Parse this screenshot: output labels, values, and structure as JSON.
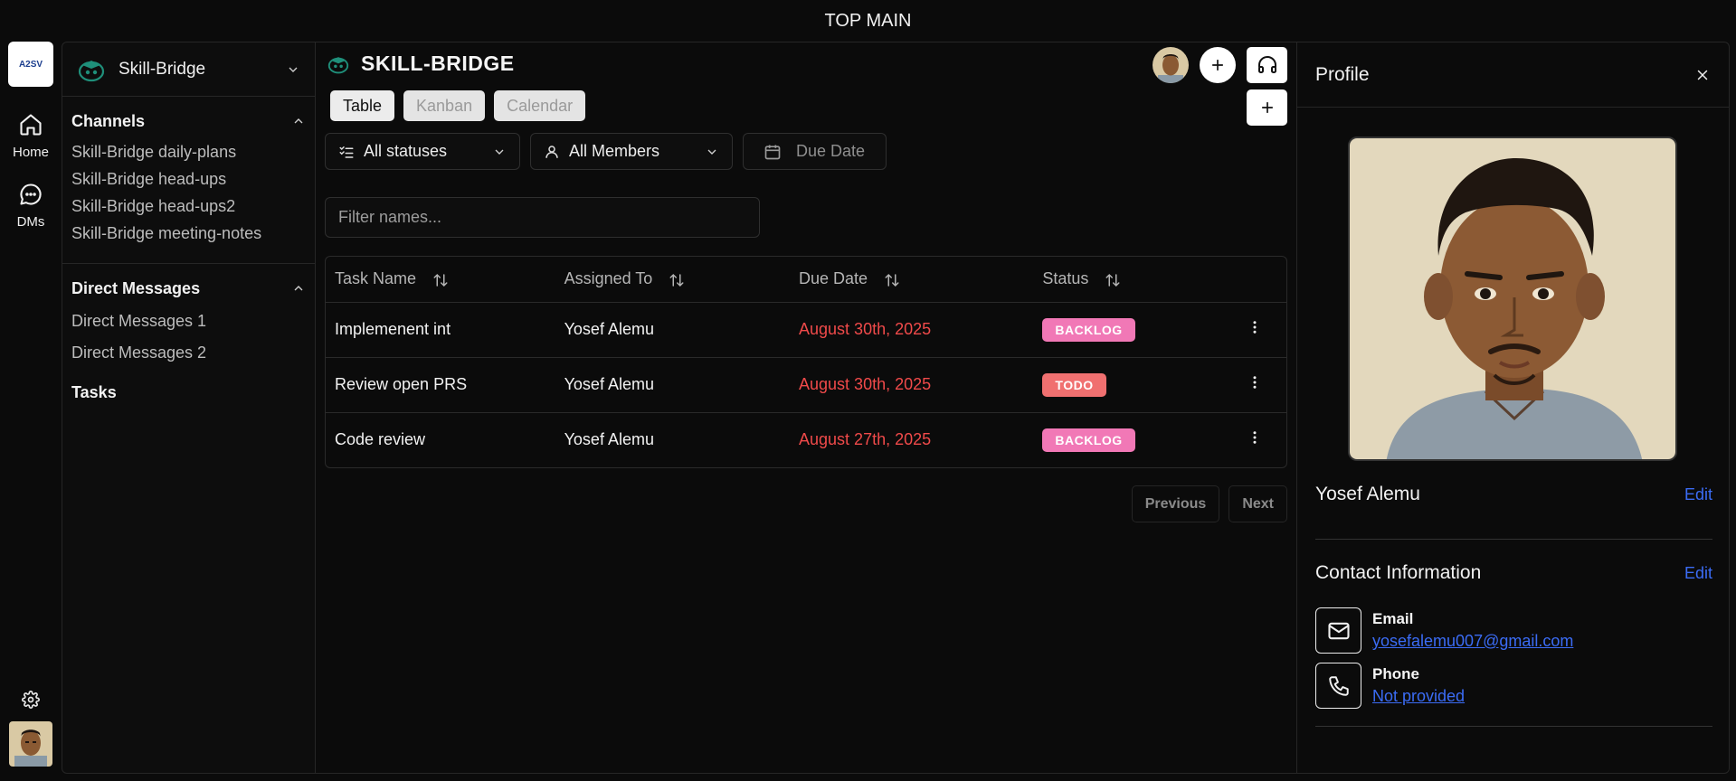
{
  "top_title": "TOP MAIN",
  "rail": {
    "logo_text": "A2SV",
    "items": [
      {
        "label": "Home",
        "icon": "home-icon"
      },
      {
        "label": "DMs",
        "icon": "chat-icon"
      }
    ]
  },
  "sidebar": {
    "workspace_name": "Skill-Bridge",
    "channels_title": "Channels",
    "channels": [
      "Skill-Bridge daily-plans",
      "Skill-Bridge head-ups",
      "Skill-Bridge head-ups2",
      "Skill-Bridge meeting-notes"
    ],
    "dm_title": "Direct Messages",
    "dms": [
      "Direct Messages 1",
      "Direct Messages 2"
    ],
    "tasks_title": "Tasks"
  },
  "main": {
    "title": "SKILL-BRIDGE",
    "tabs": [
      {
        "label": "Table",
        "active": true
      },
      {
        "label": "Kanban",
        "active": false
      },
      {
        "label": "Calendar",
        "active": false
      }
    ],
    "filters": {
      "status": "All statuses",
      "members": "All Members",
      "due": "Due Date"
    },
    "search_placeholder": "Filter names...",
    "columns": [
      "Task Name",
      "Assigned To",
      "Due Date",
      "Status"
    ],
    "rows": [
      {
        "name": "Implemenent int",
        "assignee": "Yosef Alemu",
        "due": "August 30th, 2025",
        "status": "BACKLOG",
        "status_color": "#f178b6"
      },
      {
        "name": "Review open PRS",
        "assignee": "Yosef Alemu",
        "due": "August 30th, 2025",
        "status": "TODO",
        "status_color": "#f07070"
      },
      {
        "name": "Code review",
        "assignee": "Yosef Alemu",
        "due": "August 27th, 2025",
        "status": "BACKLOG",
        "status_color": "#f178b6"
      }
    ],
    "pager": {
      "previous": "Previous",
      "next": "Next"
    }
  },
  "profile": {
    "title": "Profile",
    "name": "Yosef Alemu",
    "edit_label": "Edit",
    "contact_title": "Contact Information",
    "email_label": "Email",
    "email": "yosefalemu007@gmail.com",
    "phone_label": "Phone",
    "phone": "Not provided"
  },
  "colors": {
    "accent_link": "#3b6cf5",
    "due_overdue": "#f04a4a",
    "backlog": "#f178b6",
    "todo": "#f07070"
  }
}
